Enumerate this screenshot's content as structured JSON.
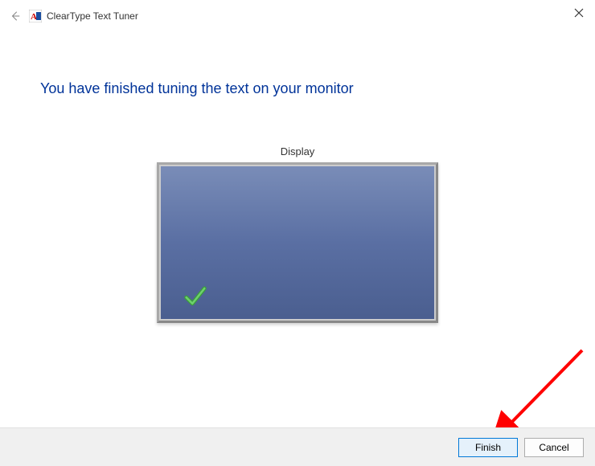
{
  "window": {
    "title": "ClearType Text Tuner"
  },
  "main": {
    "heading": "You have finished tuning the text on your monitor",
    "display_label": "Display"
  },
  "footer": {
    "finish_label": "Finish",
    "cancel_label": "Cancel"
  },
  "colors": {
    "heading": "#003399",
    "monitor_top": "#7a8db8",
    "monitor_bottom": "#4a5e8f",
    "footer_bg": "#f0f0f0",
    "primary_border": "#0078d7",
    "arrow": "#ff0000",
    "check": "#4caf50"
  }
}
